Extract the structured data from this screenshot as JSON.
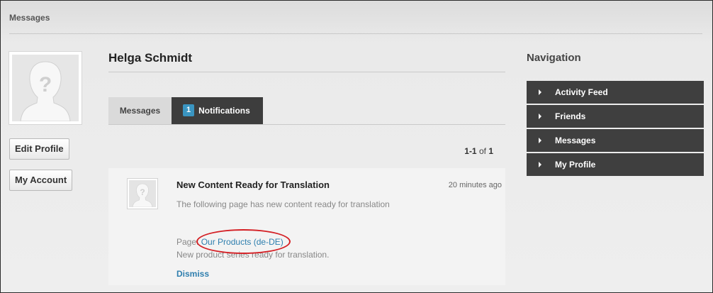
{
  "module": {
    "title": "Messages"
  },
  "profile": {
    "name": "Helga Schmidt",
    "edit_profile_label": "Edit Profile",
    "my_account_label": "My Account"
  },
  "tabs": {
    "messages_label": "Messages",
    "notifications_label": "Notifications",
    "notifications_badge": "1"
  },
  "pager": {
    "range": "1-1",
    "of_label": "of",
    "total": "1"
  },
  "notification": {
    "title": "New Content Ready for Translation",
    "time": "20 minutes ago",
    "description": "The following page has new content ready for translation",
    "page_prefix": "Page:",
    "page_link": "Our Products (de-DE)",
    "note": "New product series ready for translation.",
    "dismiss_label": "Dismiss"
  },
  "navigation": {
    "title": "Navigation",
    "items": [
      {
        "label": "Activity Feed"
      },
      {
        "label": "Friends"
      },
      {
        "label": "Messages"
      },
      {
        "label": "My Profile"
      }
    ]
  },
  "colors": {
    "accent_link": "#2f7fae",
    "badge": "#3a95c1",
    "dark_panel": "#3f3f3f",
    "highlight": "#d41f24"
  }
}
